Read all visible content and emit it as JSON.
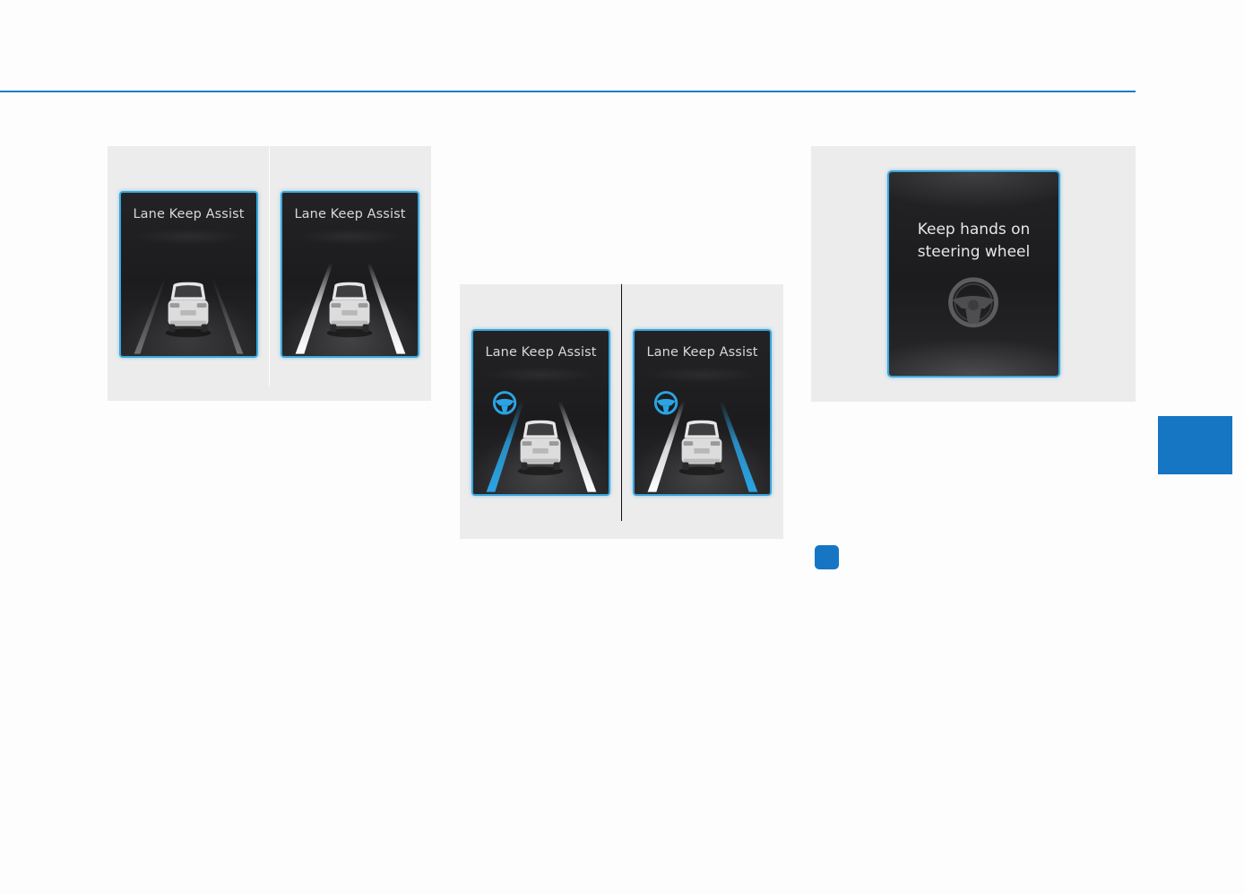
{
  "colors": {
    "accent_blue": "#1a7cc8",
    "screen_border": "#3aa6dc",
    "screen_bg": "#1e1e20",
    "figure_bg": "#ececec",
    "lane_white": "#e8e8e8",
    "lane_active": "#2aa4e4"
  },
  "figures": {
    "lka_standby": {
      "left_screen": {
        "title": "Lane Keep Assist",
        "lanes": "not-detected"
      },
      "right_screen": {
        "title": "Lane Keep Assist",
        "lanes": "detected"
      }
    },
    "lka_active": {
      "left_screen": {
        "title": "Lane Keep Assist",
        "active_lane": "left",
        "icon": "steering-wheel-icon"
      },
      "right_screen": {
        "title": "Lane Keep Assist",
        "active_lane": "right",
        "icon": "steering-wheel-icon"
      }
    },
    "hands_off_warning": {
      "screen": {
        "line1": "Keep hands on",
        "line2": "steering wheel",
        "icon": "steering-wheel-icon"
      }
    }
  }
}
